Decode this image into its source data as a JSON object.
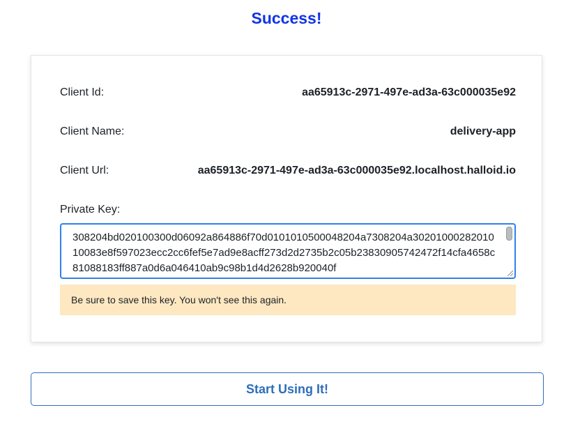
{
  "header": {
    "title": "Success!"
  },
  "client": {
    "id_label": "Client Id:",
    "id_value": "aa65913c-2971-497e-ad3a-63c000035e92",
    "name_label": "Client Name:",
    "name_value": "delivery-app",
    "url_label": "Client Url:",
    "url_value": "aa65913c-2971-497e-ad3a-63c000035e92.localhost.halloid.io"
  },
  "private_key": {
    "label": "Private Key:",
    "value": "308204bd020100300d06092a864886f70d0101010500048204a7308204a3020100028201010083e8f597023ecc2cc6fef5e7ad9e8acff273d2d2735b2c05b23830905742472f14cfa4658c81088183ff887a0d6a046410ab9c98b1d4d2628b920040f"
  },
  "warning": {
    "text": "Be sure to save this key. You won't see this again."
  },
  "actions": {
    "start_label": "Start Using It!"
  },
  "colors": {
    "title": "#1233e6",
    "accent": "#2e6dba",
    "focus_border": "#2f80ed",
    "warning_bg": "#fde8c1"
  }
}
